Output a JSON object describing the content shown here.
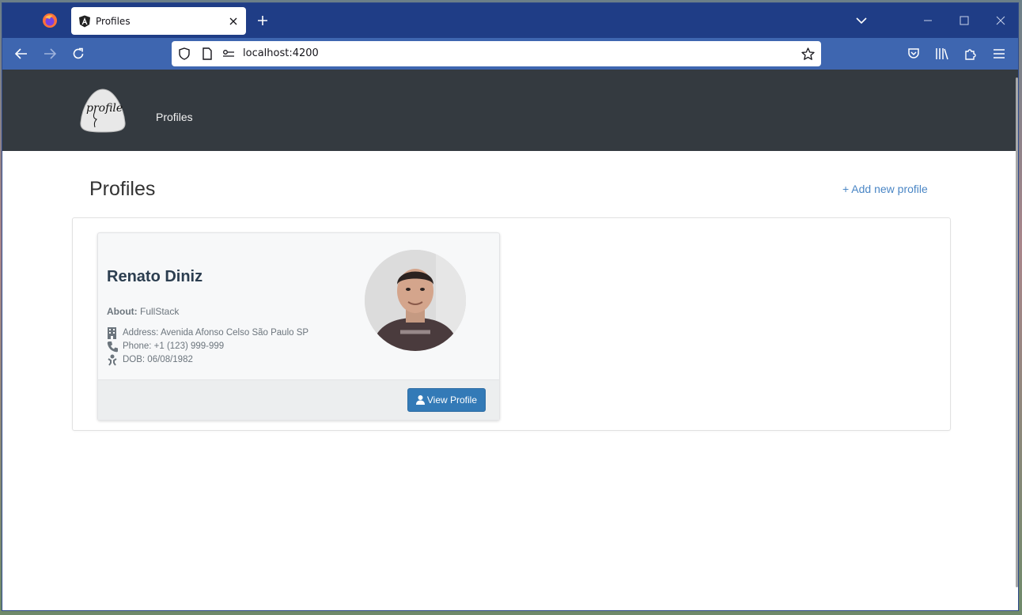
{
  "browser": {
    "tab_title": "Profiles",
    "url": "localhost:4200"
  },
  "site": {
    "logo_text": "profile",
    "nav_link": "Profiles"
  },
  "main": {
    "title": "Profiles",
    "add_link": "+ Add new profile"
  },
  "profile_card": {
    "name": "Renato Diniz",
    "about_label": "About:",
    "about_value": "FullStack",
    "address": "Address: Avenida Afonso Celso São Paulo SP",
    "phone": "Phone: +1 (123) 999-999",
    "dob": "DOB: 06/08/1982",
    "button_label": "View Profile"
  },
  "colors": {
    "tab_strip": "#1f3d86",
    "toolbar": "#3e66b0",
    "site_header": "#343a40",
    "link": "#4a86c5",
    "button": "#337ab7"
  }
}
